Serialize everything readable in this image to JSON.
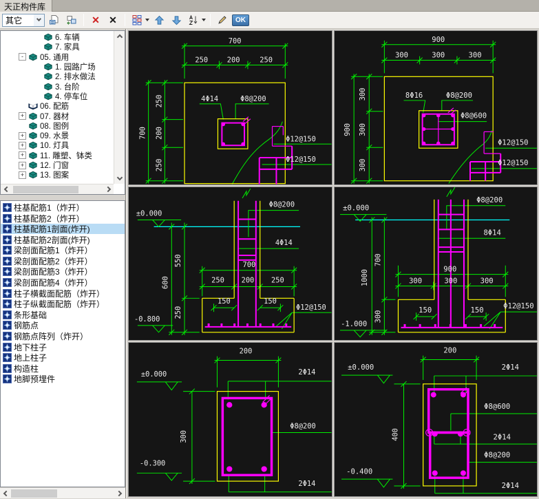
{
  "window": {
    "title": "天正构件库"
  },
  "toolbar": {
    "category_value": "其它",
    "ok_label": "OK",
    "icons": [
      "insert-block",
      "replace-block",
      "delete-red",
      "delete-black",
      "view-grid",
      "move-up",
      "move-down",
      "sort-az",
      "edit",
      "ok"
    ]
  },
  "tree": {
    "items": [
      {
        "label": "6. 车辆",
        "level": 2,
        "expander": "",
        "icon": "book"
      },
      {
        "label": "7. 家具",
        "level": 2,
        "expander": "",
        "icon": "book"
      },
      {
        "label": "05. 通用",
        "level": 1,
        "expander": "-",
        "icon": "book"
      },
      {
        "label": "1. 园路广场",
        "level": 2,
        "expander": "",
        "icon": "book"
      },
      {
        "label": "2. 排水做法",
        "level": 2,
        "expander": "",
        "icon": "book"
      },
      {
        "label": "3. 台阶",
        "level": 2,
        "expander": "",
        "icon": "book"
      },
      {
        "label": "4. 停车位",
        "level": 2,
        "expander": "",
        "icon": "book"
      },
      {
        "label": "06. 配筋",
        "level": 1,
        "expander": "",
        "icon": "open-book"
      },
      {
        "label": "07. 器材",
        "level": 1,
        "expander": "+",
        "icon": "book"
      },
      {
        "label": "08. 图例",
        "level": 1,
        "expander": "",
        "icon": "book"
      },
      {
        "label": "09. 水景",
        "level": 1,
        "expander": "+",
        "icon": "book"
      },
      {
        "label": "10. 灯具",
        "level": 1,
        "expander": "+",
        "icon": "book"
      },
      {
        "label": "11. 雕塑、钵类",
        "level": 1,
        "expander": "+",
        "icon": "book"
      },
      {
        "label": "12. 门窗",
        "level": 1,
        "expander": "+",
        "icon": "book"
      },
      {
        "label": "13. 图案",
        "level": 1,
        "expander": "+",
        "icon": "book"
      }
    ]
  },
  "list": {
    "selected_index": 2,
    "items": [
      {
        "label": "柱基配筋1（炸开）"
      },
      {
        "label": "柱基配筋2（炸开）"
      },
      {
        "label": "柱基配筋1剖面(炸开)"
      },
      {
        "label": "柱基配筋2剖面(炸开)"
      },
      {
        "label": "梁剖面配筋1（炸开）"
      },
      {
        "label": "梁剖面配筋2（炸开）"
      },
      {
        "label": "梁剖面配筋3（炸开）"
      },
      {
        "label": "梁剖面配筋4（炸开）"
      },
      {
        "label": "柱子横截面配筋（炸开）"
      },
      {
        "label": "柱子纵截面配筋（炸开）"
      },
      {
        "label": "条形基础"
      },
      {
        "label": "钢筋点"
      },
      {
        "label": "钢筋点阵列（炸开）"
      },
      {
        "label": "地下柱子"
      },
      {
        "label": "地上柱子"
      },
      {
        "label": "构造柱"
      },
      {
        "label": "地脚预埋件"
      }
    ]
  },
  "drawings": [
    {
      "type": "plan",
      "dim_total_top": "700",
      "dim_top": [
        "250",
        "200",
        "250"
      ],
      "dim_total_left": "700",
      "dim_left": [
        "250",
        "200",
        "250"
      ],
      "label_bars": "4Φ14",
      "label_stirrup": "Φ8@200",
      "label_mesh1": "Φ12@150",
      "label_mesh2": "Φ12@150"
    },
    {
      "type": "plan",
      "dim_total_top": "900",
      "dim_top": [
        "300",
        "300",
        "300"
      ],
      "dim_total_left": "900",
      "dim_left": [
        "300",
        "300",
        "300"
      ],
      "label_bars": "8Φ16",
      "label_stirrup": "Φ8@200",
      "label_ties": "Φ8@600",
      "label_mesh1": "Φ12@150",
      "label_mesh2": "Φ12@150"
    },
    {
      "type": "section",
      "elev_top": "±0.000",
      "elev_bottom": "-0.800",
      "dim_total_v": "600",
      "dim_v": [
        "550",
        "250"
      ],
      "dim_total_w": "700",
      "dim_w": [
        "250",
        "200",
        "250"
      ],
      "dim_footing": [
        "150",
        "150"
      ],
      "label_stirrup": "Φ8@200",
      "label_bars": "4Φ14",
      "label_mesh": "Φ12@150"
    },
    {
      "type": "section",
      "elev_top": "±0.000",
      "elev_bottom": "-1.000",
      "dim_total_v": "1000",
      "dim_v": [
        "700",
        "300"
      ],
      "dim_total_w": "900",
      "dim_w": [
        "300",
        "300",
        "300"
      ],
      "dim_footing": [
        "150",
        "150"
      ],
      "label_stirrup": "Φ8@200",
      "label_bars": "8Φ14",
      "label_mesh": "Φ12@150"
    },
    {
      "type": "column-section",
      "dim_w": "200",
      "dim_h": "300",
      "elev_top": "±0.000",
      "elev_bottom": "-0.300",
      "label_top_bars": "2Φ14",
      "label_stirrup": "Φ8@200",
      "label_bottom_bars": "2Φ14"
    },
    {
      "type": "column-section",
      "dim_w": "200",
      "dim_h": "400",
      "elev_top": "±0.000",
      "elev_bottom": "-0.400",
      "label_top_bars": "2Φ14",
      "label_ties": "Φ8@600",
      "label_mid_bars": "2Φ14",
      "label_stirrup": "Φ8@200",
      "label_bottom_bars": "2Φ14"
    }
  ],
  "colors": {
    "cad_background": "#151515",
    "dimension_green": "#00ef00",
    "outline_yellow": "#ffff00",
    "rebar_magenta": "#ff00ff",
    "ground_cyan": "#00ffff",
    "selection_blue": "#b9dcf5"
  }
}
